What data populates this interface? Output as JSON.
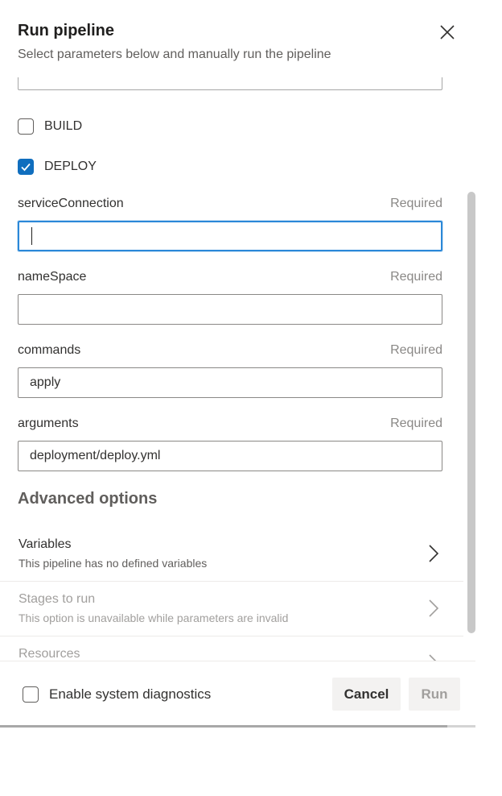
{
  "dialog": {
    "title": "Run pipeline",
    "subtitle": "Select parameters below and manually run the pipeline"
  },
  "checkboxes": [
    {
      "label": "BUILD",
      "checked": false
    },
    {
      "label": "DEPLOY",
      "checked": true
    }
  ],
  "fields": [
    {
      "label": "serviceConnection",
      "required": "Required",
      "value": "",
      "focused": true
    },
    {
      "label": "nameSpace",
      "required": "Required",
      "value": ""
    },
    {
      "label": "commands",
      "required": "Required",
      "value": "apply"
    },
    {
      "label": "arguments",
      "required": "Required",
      "value": "deployment/deploy.yml"
    }
  ],
  "advanced": {
    "heading": "Advanced options",
    "options": [
      {
        "title": "Variables",
        "description": "This pipeline has no defined variables",
        "disabled": false
      },
      {
        "title": "Stages to run",
        "description": "This option is unavailable while parameters are invalid",
        "disabled": true
      },
      {
        "title": "Resources",
        "description": "",
        "disabled": true
      }
    ]
  },
  "footer": {
    "diagnostics_label": "Enable system diagnostics",
    "diagnostics_checked": false,
    "cancel_label": "Cancel",
    "run_label": "Run"
  },
  "colors": {
    "accent": "#106ebe",
    "focus_border": "#2b88d8",
    "muted_text": "#605e5c",
    "disabled_text": "#a19f9d"
  },
  "icons": {
    "close": "close-icon",
    "chevron": "chevron-right-icon",
    "check": "checkmark-icon"
  }
}
